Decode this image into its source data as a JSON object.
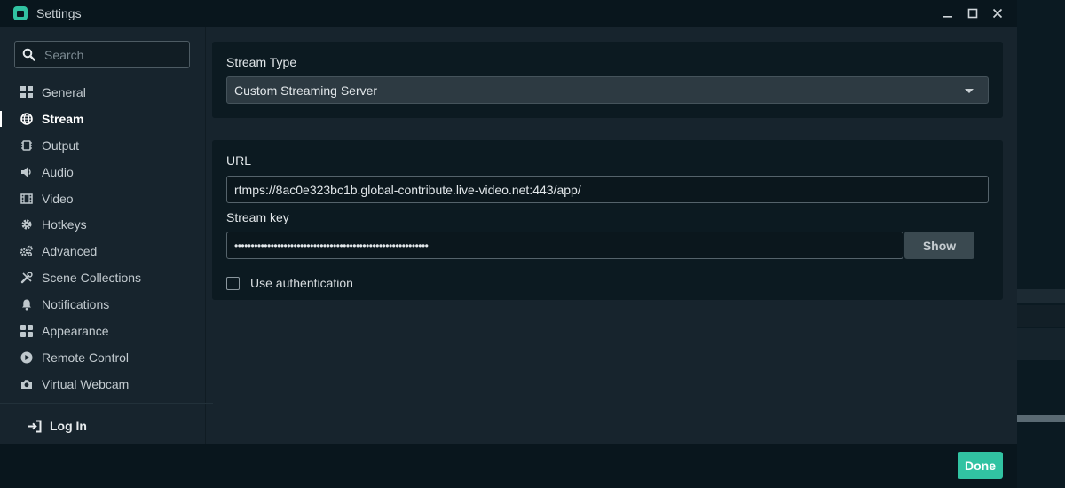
{
  "window": {
    "title": "Settings",
    "logo_icon": "streamlabs-logo-icon",
    "controls": [
      "minimize-icon",
      "maximize-icon",
      "close-icon"
    ]
  },
  "colors": {
    "accent": "#31c3a2",
    "background": "#17242d",
    "panel": "#0c1a21",
    "titlebar": "#09161d"
  },
  "sidebar": {
    "search": {
      "placeholder": "Search",
      "value": "",
      "icon": "search-icon"
    },
    "items": [
      {
        "label": "General",
        "icon": "grid-icon",
        "active": false
      },
      {
        "label": "Stream",
        "icon": "globe-icon",
        "active": true
      },
      {
        "label": "Output",
        "icon": "chip-icon",
        "active": false
      },
      {
        "label": "Audio",
        "icon": "speaker-icon",
        "active": false
      },
      {
        "label": "Video",
        "icon": "film-icon",
        "active": false
      },
      {
        "label": "Hotkeys",
        "icon": "gear-icon",
        "active": false
      },
      {
        "label": "Advanced",
        "icon": "gears-icon",
        "active": false
      },
      {
        "label": "Scene Collections",
        "icon": "tools-icon",
        "active": false
      },
      {
        "label": "Notifications",
        "icon": "bell-icon",
        "active": false
      },
      {
        "label": "Appearance",
        "icon": "grid-icon",
        "active": false
      },
      {
        "label": "Remote Control",
        "icon": "play-circle-icon",
        "active": false
      },
      {
        "label": "Virtual Webcam",
        "icon": "camera-icon",
        "active": false
      }
    ],
    "login": {
      "label": "Log In",
      "icon": "login-icon"
    }
  },
  "stream_type": {
    "label": "Stream Type",
    "selected": "Custom Streaming Server"
  },
  "server": {
    "url_label": "URL",
    "url_value": "rtmps://8ac0e323bc1b.global-contribute.live-video.net:443/app/",
    "key_label": "Stream key",
    "key_value": "•••••••••••••••••••••••••••••••••••••••••••••••••••••••••••",
    "show_label": "Show",
    "auth_label": "Use authentication",
    "auth_checked": false
  },
  "footer": {
    "done_label": "Done"
  }
}
